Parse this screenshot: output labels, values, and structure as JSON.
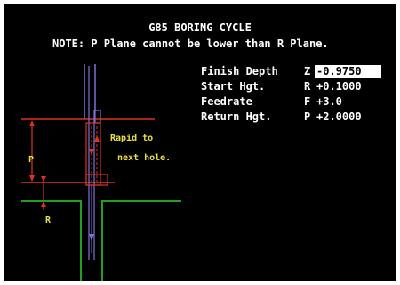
{
  "screen": {
    "title": "G85 BORING CYCLE",
    "note": "NOTE: P Plane cannot be lower than R Plane."
  },
  "params": [
    {
      "label": "Finish Depth",
      "letter": "Z",
      "value": "-0.9750",
      "active": true
    },
    {
      "label": "Start Hgt.",
      "letter": "R",
      "value": "+0.1000",
      "active": false
    },
    {
      "label": "Feedrate",
      "letter": "F",
      "value": "+3.0",
      "active": false
    },
    {
      "label": "Return Hgt.",
      "letter": "P",
      "value": "+2.0000",
      "active": false
    }
  ],
  "diagram": {
    "rapid_label_line1": "Rapid to",
    "rapid_label_line2": "next hole.",
    "p_label": "P",
    "r_label": "R"
  },
  "colors": {
    "background": "#000000",
    "text": "#ffffff",
    "dimension": "#e03020",
    "label": "#e8e040",
    "surface": "#20a020",
    "tool": "#8070d8",
    "highlight": "#ffffff"
  }
}
